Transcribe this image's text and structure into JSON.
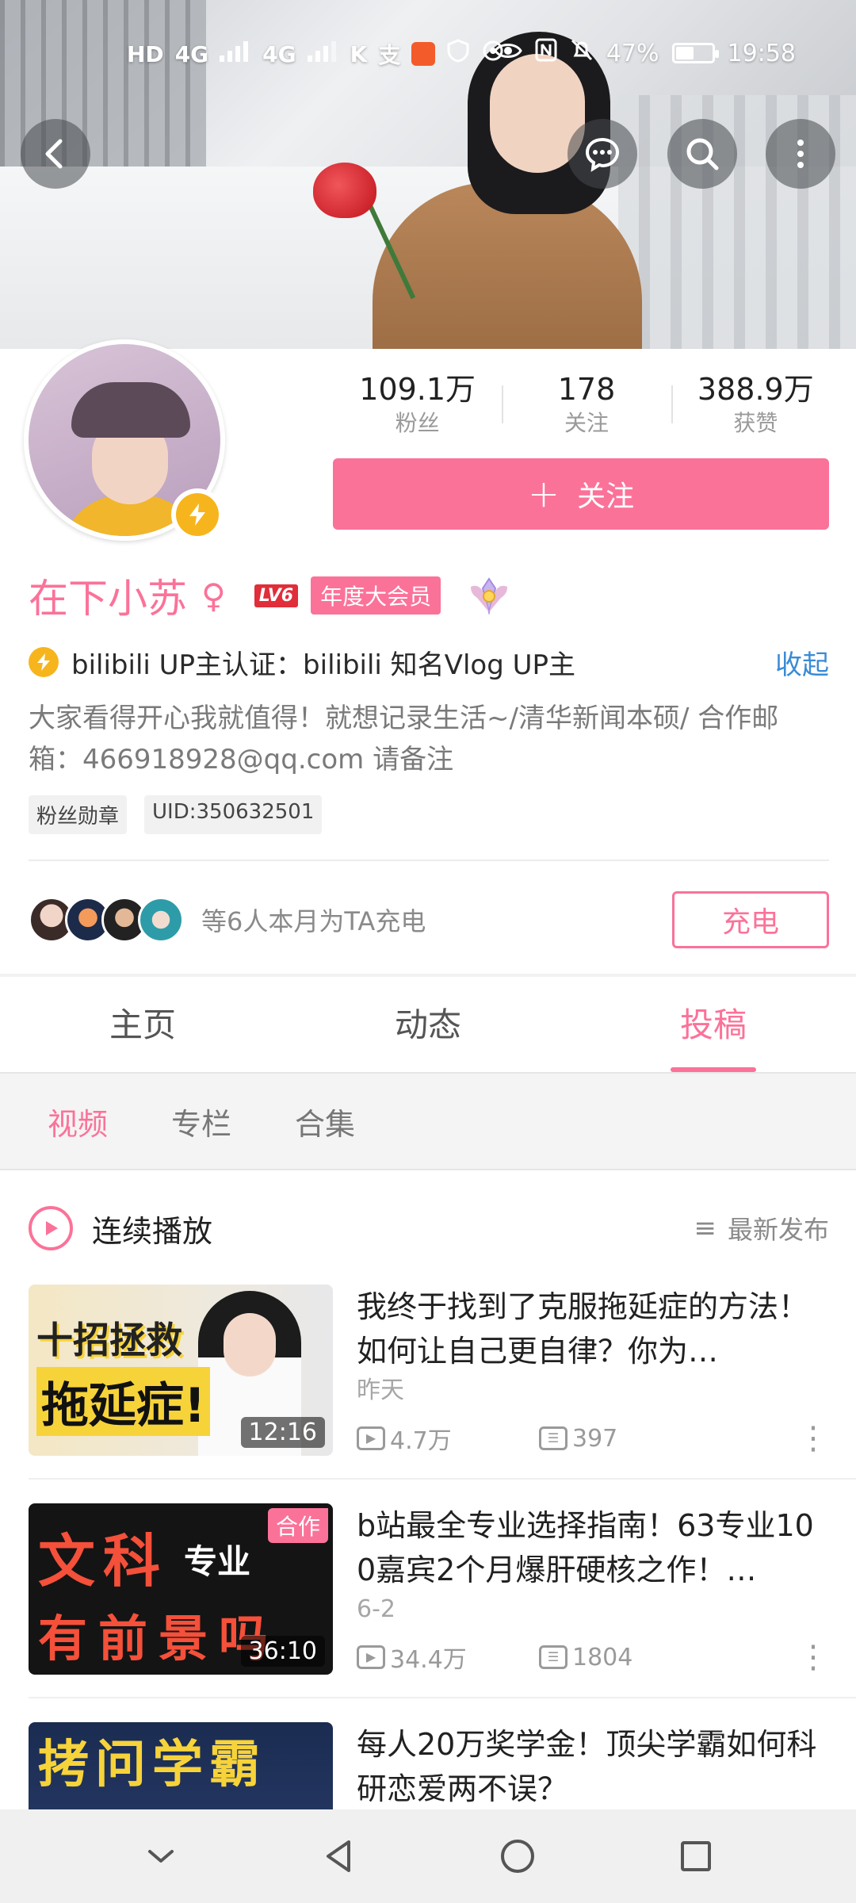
{
  "status_bar": {
    "left_items": [
      "HD",
      "4G",
      "4G",
      "K",
      "支"
    ],
    "battery_percent": "47%",
    "battery_level": 0.47,
    "time": "19:58"
  },
  "header": {
    "back_icon": "chevron-left-icon",
    "message_icon": "message-bubble-icon",
    "search_icon": "search-icon",
    "more_icon": "more-vertical-icon"
  },
  "profile": {
    "stats": [
      {
        "value": "109.1万",
        "label": "粉丝"
      },
      {
        "value": "178",
        "label": "关注"
      },
      {
        "value": "388.9万",
        "label": "获赞"
      }
    ],
    "follow_button": {
      "icon": "+",
      "label": "关注"
    },
    "name": "在下小苏",
    "gender_icon": "♀",
    "level": "LV6",
    "vip_label": "年度大会员",
    "certification": "bilibili UP主认证：bilibili 知名Vlog UP主",
    "collapse_label": "收起",
    "bio": "大家看得开心我就值得！就想记录生活~/清华新闻本硕/ 合作邮箱：466918928@qq.com 请备注",
    "tags": [
      "粉丝勋章",
      "UID:350632501"
    ],
    "charge_text": "等6人本月为TA充电",
    "charge_button": "充电",
    "accent_color": "#fb7299",
    "link_color": "#3a8bd5"
  },
  "main_tabs": [
    {
      "label": "主页",
      "active": false
    },
    {
      "label": "动态",
      "active": false
    },
    {
      "label": "投稿",
      "active": true
    }
  ],
  "sub_tabs": [
    {
      "label": "视频",
      "active": true
    },
    {
      "label": "专栏",
      "active": false
    },
    {
      "label": "合集",
      "active": false
    }
  ],
  "list_header": {
    "play_all_label": "连续播放",
    "sort_icon": "≡",
    "sort_label": "最新发布"
  },
  "videos": [
    {
      "thumb_text_1": "十招拯救",
      "thumb_text_2": "拖延症!",
      "duration": "12:16",
      "coop_label": "",
      "title": "我终于找到了克服拖延症的方法！如何让自己更自律？你为…",
      "date": "昨天",
      "views": "4.7万",
      "danmaku": "397"
    },
    {
      "thumb_text_1": "文科",
      "thumb_text_1b": "专业",
      "thumb_text_2": "有前景吗",
      "duration": "36:10",
      "coop_label": "合作",
      "title": "b站最全专业选择指南！63专业100嘉宾2个月爆肝硬核之作！…",
      "date": "6-2",
      "views": "34.4万",
      "danmaku": "1804"
    },
    {
      "thumb_text_1": "拷问学霸",
      "thumb_text_2": "",
      "duration": "",
      "coop_label": "",
      "title": "每人20万奖学金！顶尖学霸如何科研恋爱两不误？",
      "date": "",
      "views": "",
      "danmaku": ""
    }
  ],
  "nav_bar": {
    "icons": [
      "collapse-down-icon",
      "back-triangle-icon",
      "home-circle-icon",
      "recents-square-icon"
    ]
  }
}
